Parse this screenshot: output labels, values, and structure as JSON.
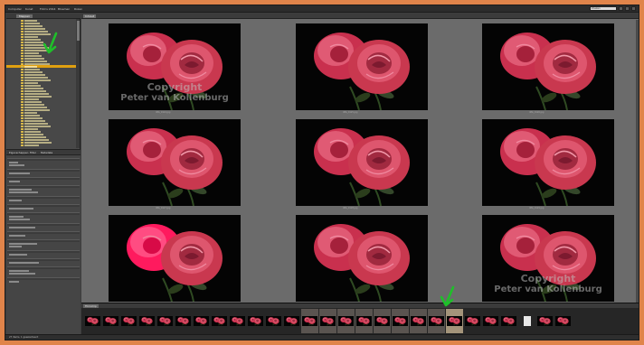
{
  "topbar": {
    "breadcrumbs": [
      "Computer",
      "Kunst",
      "Foto's 2014",
      "Bloemen",
      "Rozen"
    ],
    "search_placeholder": "Zoeken"
  },
  "left_panel": {
    "folders_tab": "Mappen",
    "properties_tabs": [
      "Eigenschappen",
      "Filter",
      "Metadata"
    ]
  },
  "grid": {
    "tab": "Inhoud",
    "captions": [
      "IMG_0124.jpg",
      "IMG_0125.jpg",
      "IMG_0126.jpg",
      "IMG_0127.jpg",
      "IMG_0128.jpg",
      "IMG_0129.jpg",
      "IMG_0130.jpg",
      "IMG_0131.jpg",
      "IMG_0132.jpg"
    ]
  },
  "watermark": {
    "line1": "Copyright",
    "line2": "Peter van Kollenburg"
  },
  "filmstrip": {
    "tab": "Filmstrip",
    "count": 27
  },
  "status": {
    "text": "27 items, 1 geselecteerd"
  },
  "colors": {
    "frame": "#e0844a",
    "selection": "#e0a010",
    "arrow": "#1fbf2a"
  }
}
